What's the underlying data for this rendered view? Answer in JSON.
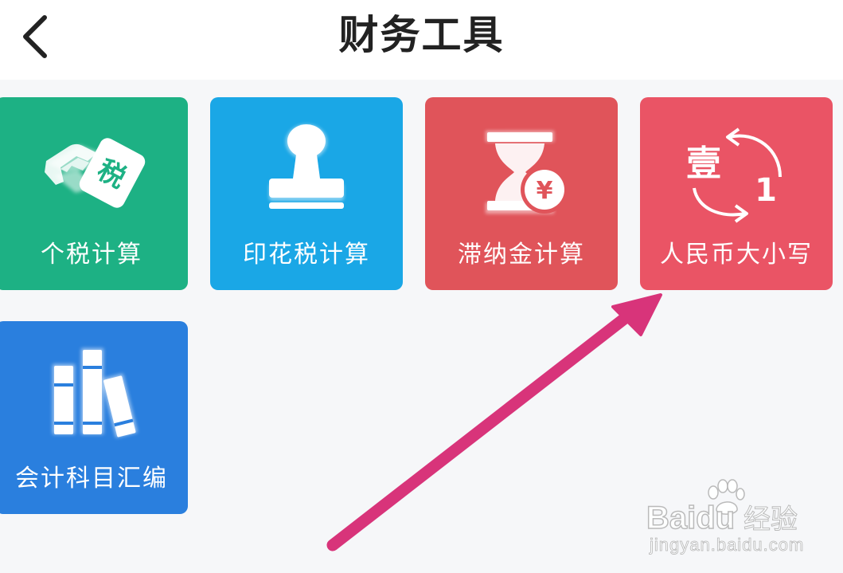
{
  "header": {
    "title": "财务工具",
    "back_icon": "chevron-left-icon"
  },
  "tools": [
    {
      "label": "个税计算",
      "icon": "tax-handshake-icon",
      "color": "#1db184",
      "icon_char": "税"
    },
    {
      "label": "印花税计算",
      "icon": "stamp-icon",
      "color": "#1aa7e6"
    },
    {
      "label": "滞纳金计算",
      "icon": "hourglass-yen-icon",
      "color": "#e0545a",
      "icon_char": "¥"
    },
    {
      "label": "人民币大小写",
      "icon": "currency-case-convert-icon",
      "color": "#ea5465",
      "icon_char": "壹",
      "icon_digit": "1"
    },
    {
      "label": "会计科目汇编",
      "icon": "books-icon",
      "color": "#2a7fde"
    }
  ],
  "annotation": {
    "arrow_color": "#d8347a",
    "points_to": "人民币大小写"
  },
  "watermark": {
    "brand": "Baidu",
    "sub": "经验",
    "url": "jingyan.baidu.com"
  }
}
